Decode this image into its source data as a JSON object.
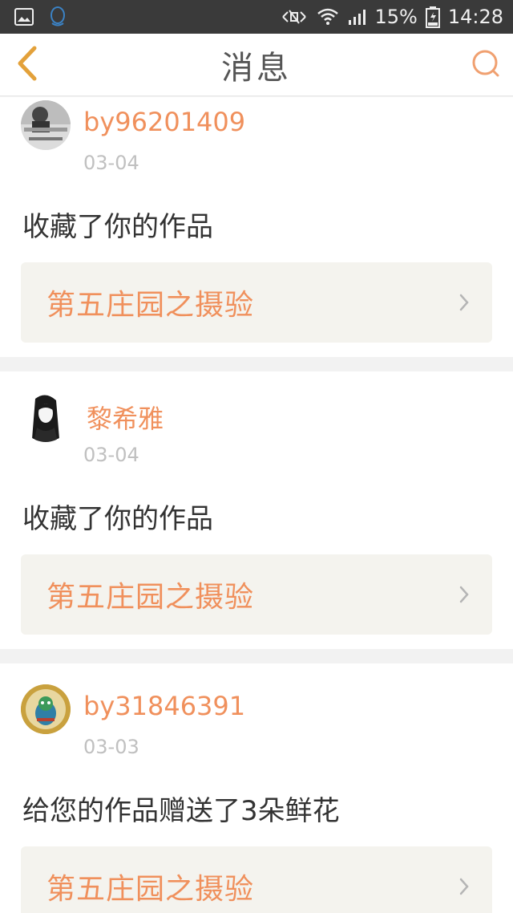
{
  "status_bar": {
    "battery_percent": "15%",
    "time": "14:28",
    "icons": [
      "gallery-icon",
      "qq-icon",
      "mute-icon",
      "wifi-icon",
      "signal-icon",
      "battery-icon"
    ]
  },
  "header": {
    "title": "消息",
    "back_icon": "chevron-left-icon",
    "search_icon": "search-icon"
  },
  "colors": {
    "accent": "#f0905c",
    "status_bar": "#3a3a3a",
    "card_link_bg": "#f4f3ee"
  },
  "notifications": [
    {
      "username": "by96201409",
      "date": "03-04",
      "message": "收藏了你的作品",
      "work_title": "第五庄园之摄验",
      "avatar": "avatar-girl-photo"
    },
    {
      "username": "黎希雅",
      "date": "03-04",
      "message": "收藏了你的作品",
      "work_title": "第五庄园之摄验",
      "avatar": "avatar-anime-girl"
    },
    {
      "username": "by31846391",
      "date": "03-03",
      "message": "给您的作品赠送了3朵鲜花",
      "work_title": "第五庄园之摄验",
      "avatar": "avatar-cartoon-figure"
    }
  ]
}
